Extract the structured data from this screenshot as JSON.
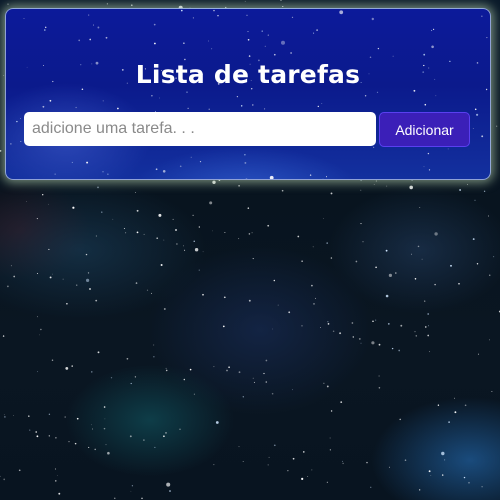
{
  "app": {
    "title": "Lista de tarefas"
  },
  "form": {
    "input_value": "",
    "input_placeholder": "adicione uma tarefa. . .",
    "add_button_label": "Adicionar"
  },
  "colors": {
    "card_background": "#0c1a9a",
    "button_background": "#3b1fb8",
    "title_text": "#ffffff"
  }
}
